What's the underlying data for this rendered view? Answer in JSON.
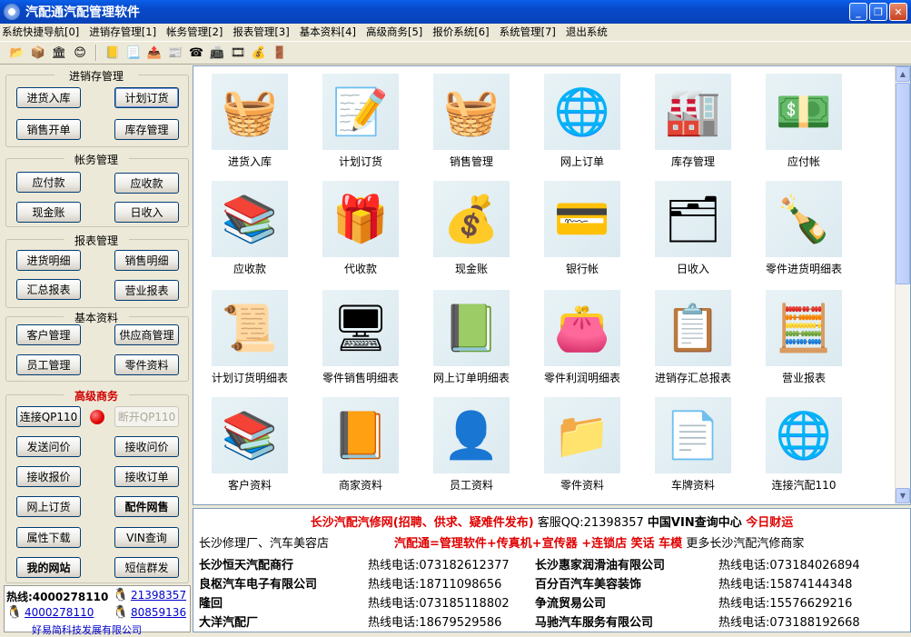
{
  "window": {
    "title": "汽配通汽配管理软件"
  },
  "menu": [
    "系统快捷导航[0]",
    "进销存管理[1]",
    "帐务管理[2]",
    "报表管理[3]",
    "基本资料[4]",
    "高级商务[5]",
    "报价系统[6]",
    "系统管理[7]",
    "退出系统"
  ],
  "toolbar_icons": [
    "folder-open-icon",
    "package-icon",
    "bank-icon",
    "smiley-icon",
    "book-icon",
    "document-icon",
    "dispatch-icon",
    "ledger-icon",
    "phone-icon",
    "fax-icon",
    "film-icon",
    "money-bag-icon",
    "exit-door-icon"
  ],
  "sidebar": {
    "groups": [
      {
        "title": "进销存管理",
        "buttons": [
          "进货入库",
          "计划订货",
          "销售开单",
          "库存管理"
        ]
      },
      {
        "title": "帐务管理",
        "buttons": [
          "应付款",
          "应收款",
          "现金账",
          "日收入"
        ]
      },
      {
        "title": "报表管理",
        "buttons": [
          "进货明细",
          "销售明细",
          "汇总报表",
          "营业报表"
        ]
      },
      {
        "title": "基本资料",
        "buttons": [
          "客户管理",
          "供应商管理",
          "员工管理",
          "零件资料"
        ]
      },
      {
        "title": "高级商务",
        "buttons": [
          "连接QP110",
          "断开QP110",
          "发送问价",
          "接收问价",
          "接收报价",
          "接收订单",
          "网上订货",
          "配件网售",
          "属性下载",
          "VIN查询",
          "我的网站",
          "短信群发"
        ]
      }
    ],
    "hotline": {
      "label": "热线:4000278110",
      "qq1": "21398357",
      "phone2": "4000278110",
      "qq2": "80859136",
      "company": "好易简科技发展有限公司"
    }
  },
  "icons": [
    {
      "label": "进货入库",
      "glyph": "🧺"
    },
    {
      "label": "计划订货",
      "glyph": "📝"
    },
    {
      "label": "销售管理",
      "glyph": "🧺"
    },
    {
      "label": "网上订单",
      "glyph": "🌐"
    },
    {
      "label": "库存管理",
      "glyph": "🏭"
    },
    {
      "label": "应付帐",
      "glyph": "💵"
    },
    {
      "label": "应收款",
      "glyph": "📚"
    },
    {
      "label": "代收款",
      "glyph": "🎁"
    },
    {
      "label": "现金账",
      "glyph": "💰"
    },
    {
      "label": "银行帐",
      "glyph": "💳"
    },
    {
      "label": "日收入",
      "glyph": "🗂"
    },
    {
      "label": "零件进货明细表",
      "glyph": "🍾"
    },
    {
      "label": "计划订货明细表",
      "glyph": "📜"
    },
    {
      "label": "零件销售明细表",
      "glyph": "🖥"
    },
    {
      "label": "网上订单明细表",
      "glyph": "📗"
    },
    {
      "label": "零件利润明细表",
      "glyph": "👛"
    },
    {
      "label": "进销存汇总报表",
      "glyph": "📋"
    },
    {
      "label": "营业报表",
      "glyph": "🧮"
    },
    {
      "label": "客户资料",
      "glyph": "📚"
    },
    {
      "label": "商家资料",
      "glyph": "📙"
    },
    {
      "label": "员工资料",
      "glyph": "👤"
    },
    {
      "label": "零件资料",
      "glyph": "📁"
    },
    {
      "label": "车牌资料",
      "glyph": "📄"
    },
    {
      "label": "连接汽配110",
      "glyph": "🌐"
    }
  ],
  "ads": {
    "line1_red": "长沙汽配汽修网(招聘、供求、疑难件发布)",
    "line1_qq": " 客服QQ:21398357 ",
    "line1_vin": "中国VIN查询中心",
    "line1_news": " 今日财运",
    "line2_a": "长沙修理厂、汽车美容店",
    "line2_red": "汽配通=管理软件+传真机+宣传器 +连锁店",
    "line2_b": "  笑话 车模",
    "line2_c": " 更多长沙汽配汽修商家",
    "rows": [
      {
        "name1": "长沙恒天汽配商行",
        "phone1": "热线电话:073182612377",
        "name2": "长沙惠家润滑油有限公司",
        "phone2": "热线电话:073184026894"
      },
      {
        "name1": "良枢汽车电子有限公司",
        "phone1": "热线电话:18711098656",
        "name2": "百分百汽车美容装饰",
        "phone2": "热线电话:15874144348"
      },
      {
        "name1": "隆回",
        "phone1": "热线电话:073185118802",
        "name2": "争流贸易公司",
        "phone2": "热线电话:15576629216"
      },
      {
        "name1": "大洋汽配厂",
        "phone1": "热线电话:18679529586",
        "name2": "马驰汽车服务有限公司",
        "phone2": "热线电话:073188192668"
      }
    ]
  }
}
